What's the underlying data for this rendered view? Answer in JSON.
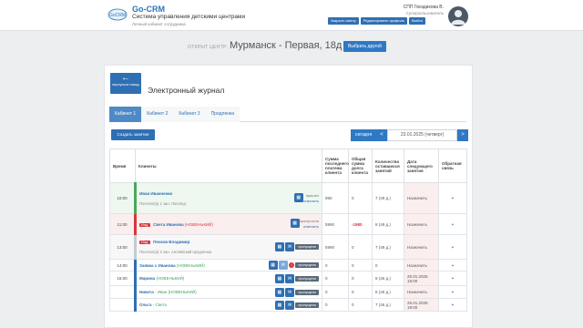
{
  "header": {
    "brand_title": "Go-CRM",
    "brand_subtitle": "Система управления детскими центрами",
    "brand_caption": "Личный кабинет сотрудника",
    "user_name": "СПП Гвоздикова В.",
    "user_role": "Суперпользователь",
    "buttons": [
      "Закрыть смену",
      "Редактировать профиль",
      "Выйти"
    ]
  },
  "center": {
    "label": "ОТКРЫТ ЦЕНТР:",
    "name": "Мурманск - Первая, 18д",
    "choose_button": "Выбрать другой"
  },
  "journal": {
    "back_label": "вернуться назад",
    "title": "Электронный журнал",
    "tabs": [
      "Кабинет 1",
      "Кабинет 2",
      "Кабинет 3",
      "Продленка"
    ],
    "active_tab": 0,
    "create_button": "Создать занятие",
    "today_button": "сегодня",
    "date": "23.01.2025 (четверг)",
    "columns": [
      "Время",
      "Клиенты",
      "Сумма последнего платежа клиента",
      "Общая сумма долга клиента",
      "Количество оставшихся занятий",
      "Дата следующего занятия",
      "Обратная связь"
    ],
    "rows": [
      {
        "time": "10:00",
        "client": "Иван Иванченко",
        "client_new": "",
        "sub": "Посетил(а) 1 зан. Логопед",
        "ind": false,
        "status": "green",
        "actions": [
          "пришел",
          "отменить"
        ],
        "payment": "990",
        "debt": "0",
        "remaining": "7 (49 д.)",
        "next": [
          "Назначить"
        ]
      },
      {
        "time": "11:00",
        "client": "Света Иванова",
        "client_new": "(НОВЕНЬКИЙ)",
        "sub": "",
        "ind": true,
        "status": "red",
        "actions": [
          "пропустила",
          "отменить"
        ],
        "payment": "5990",
        "debt": "-1980",
        "remaining": "8 (49 д.)",
        "next": [
          "Назначить"
        ]
      },
      {
        "time": "13:00",
        "client": "Песков Владимир",
        "client_new": "",
        "sub": "Посетил(а) 2 зан. Английский продленка",
        "ind": true,
        "status": "gray",
        "actions": [
          "пропущено"
        ],
        "payment": "5990",
        "debt": "0",
        "remaining": "7 (49 д.)",
        "next": [
          "Назначить"
        ]
      },
      {
        "time": "14:00",
        "client": "Заявка с Иванова",
        "client_new": "(НОВЕНЬКИЙ)",
        "sub": "",
        "ind": false,
        "status": "blue",
        "actions": [
          "пропущено"
        ],
        "payment": "0",
        "debt": "0",
        "remaining": "0",
        "next": [
          "Назначить"
        ]
      },
      {
        "time": "15:00",
        "client": "Марина",
        "client_new": "(НОВЕНЬКИЙ)",
        "sub": "",
        "ind": false,
        "status": "blue",
        "actions": [
          "пропущено"
        ],
        "payment": "0",
        "debt": "0",
        "remaining": "8 (46 д.)",
        "next": [
          "25.01.2025",
          "19:00"
        ]
      },
      {
        "time": "",
        "client": "Никита",
        "client_new": "- Иван (НОВЕНЬКИЙ)",
        "sub": "",
        "ind": false,
        "status": "blue",
        "actions": [
          "пропущено"
        ],
        "payment": "0",
        "debt": "0",
        "remaining": "8 (46 д.)",
        "next": [
          "Назначить"
        ]
      },
      {
        "time": "",
        "client": "Ольга",
        "client_new": "- Света",
        "sub": "",
        "ind": false,
        "status": "blue",
        "actions": [
          "пропущено"
        ],
        "payment": "0",
        "debt": "0",
        "remaining": "7 (46 д.)",
        "next": [
          "25.01.2025",
          "19:00"
        ]
      }
    ]
  }
}
